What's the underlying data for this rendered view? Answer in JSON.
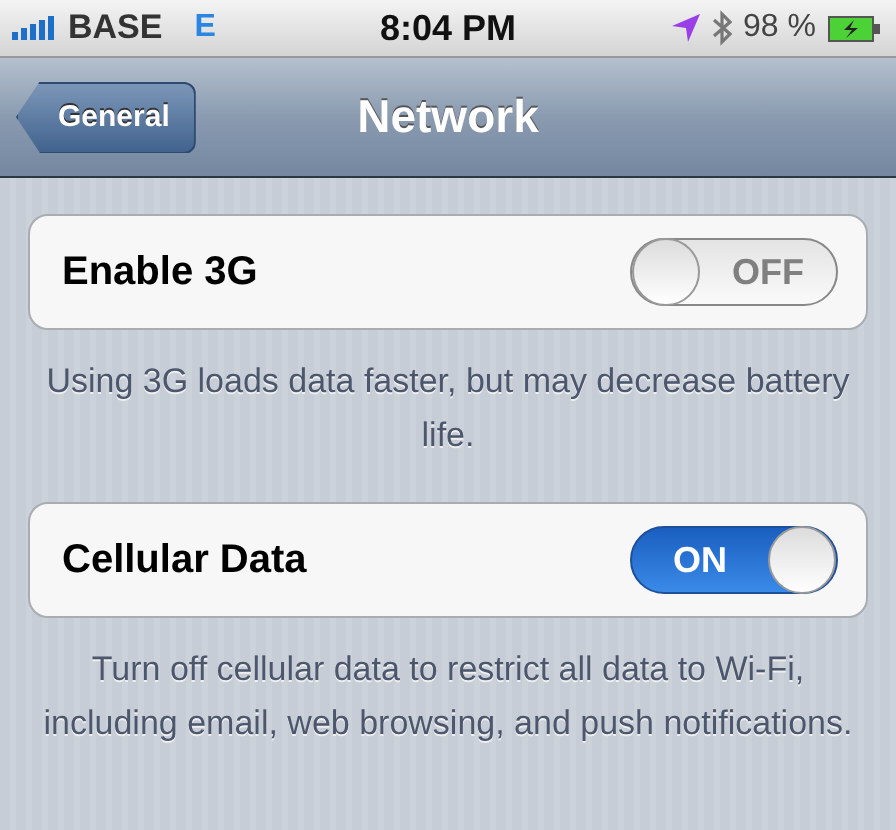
{
  "status_bar": {
    "carrier": "BASE",
    "network": "E",
    "time": "8:04 PM",
    "battery": "98 %"
  },
  "nav_bar": {
    "back_button": "General",
    "title": "Network"
  },
  "groups": [
    {
      "label": "Enable 3G",
      "switch_text": "OFF",
      "on": false,
      "footer": "Using 3G loads data faster, but may decrease battery life."
    },
    {
      "label": "Cellular Data",
      "switch_text": "ON",
      "on": true,
      "footer": "Turn off cellular data to restrict all data to Wi-Fi, including email, web browsing, and push notifications."
    }
  ]
}
